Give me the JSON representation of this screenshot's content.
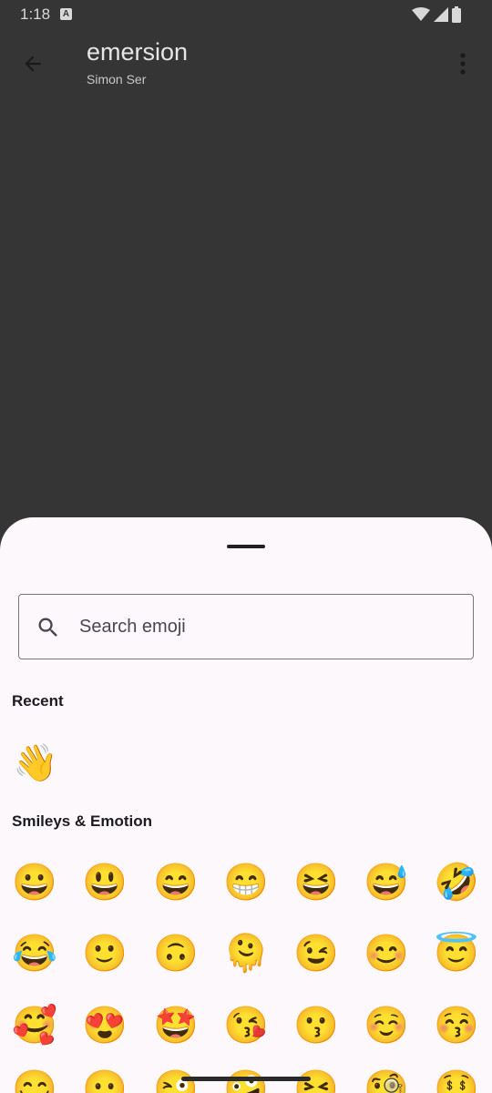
{
  "status_bar": {
    "time": "1:18",
    "notification_glyph": "A"
  },
  "app_bar": {
    "title": "emersion",
    "subtitle": "Simon Ser"
  },
  "search": {
    "placeholder": "Search emoji",
    "value": ""
  },
  "sections": {
    "recent": {
      "title": "Recent",
      "emojis": [
        "👋"
      ]
    },
    "smileys": {
      "title": "Smileys & Emotion",
      "rows": [
        [
          "😀",
          "😃",
          "😄",
          "😁",
          "😆",
          "😅",
          "🤣"
        ],
        [
          "😂",
          "🙂",
          "🙃",
          "🫠",
          "😉",
          "😊",
          "😇"
        ],
        [
          "🥰",
          "😍",
          "🤩",
          "😘",
          "😗",
          "☺️",
          "😚"
        ],
        [
          "😋",
          "😛",
          "😜",
          "🤪",
          "😝",
          "🧐",
          "🤑"
        ]
      ]
    }
  },
  "icons": {
    "back": "back-arrow-icon",
    "more": "more-vert-icon",
    "search": "search-icon",
    "wifi": "wifi-icon",
    "signal": "signal-icon",
    "battery": "battery-icon"
  },
  "colors": {
    "scrim": "#353535",
    "sheet": "#fcf8fc",
    "outline": "#7a757f"
  }
}
